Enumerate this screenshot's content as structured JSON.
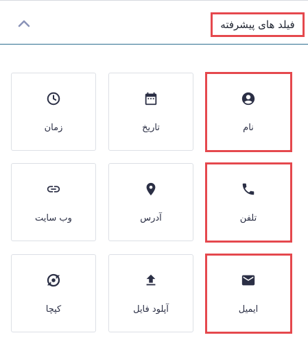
{
  "header": {
    "title": "فیلد های پیشرفته",
    "collapse_icon": "chevron-up-icon"
  },
  "fields": [
    {
      "label": "نام",
      "icon": "account-circle-icon",
      "highlighted": true
    },
    {
      "label": "تاریخ",
      "icon": "calendar-icon",
      "highlighted": false
    },
    {
      "label": "زمان",
      "icon": "clock-icon",
      "highlighted": false
    },
    {
      "label": "تلفن",
      "icon": "phone-icon",
      "highlighted": true
    },
    {
      "label": "آدرس",
      "icon": "location-pin-icon",
      "highlighted": false
    },
    {
      "label": "وب سایت",
      "icon": "link-icon",
      "highlighted": false
    },
    {
      "label": "ایمیل",
      "icon": "mail-icon",
      "highlighted": true
    },
    {
      "label": "آپلود فایل",
      "icon": "upload-icon",
      "highlighted": false
    },
    {
      "label": "کپچا",
      "icon": "captcha-icon",
      "highlighted": false
    }
  ],
  "colors": {
    "highlight": "#e5484d",
    "header_border": "#2c6d8f",
    "icon": "#2b2f45",
    "chevron": "#8a93b8"
  }
}
